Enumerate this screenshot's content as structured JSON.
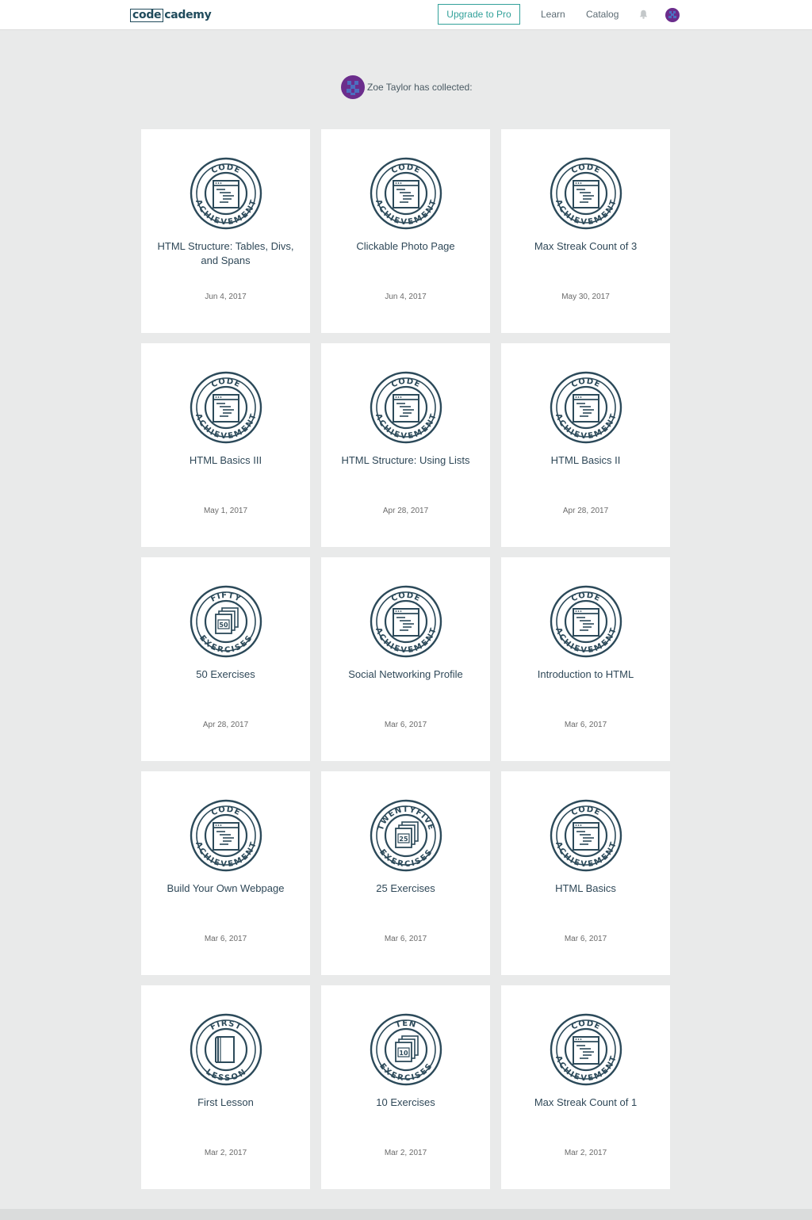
{
  "nav": {
    "logo_code": "code",
    "logo_rest": "cademy",
    "upgrade_label": "Upgrade to Pro",
    "learn_label": "Learn",
    "catalog_label": "Catalog"
  },
  "profile": {
    "name": "Zoe Taylor",
    "collected_text": "has collected:"
  },
  "colors": {
    "accent": "#32a19a",
    "badge_stroke": "#2c4a5a",
    "avatar_purple": "#6b2d8c"
  },
  "achievements": [
    {
      "title": "HTML Structure: Tables, Divs, and Spans",
      "date": "Jun 4, 2017",
      "badge": "code-achievement-icon",
      "top": "CODE",
      "bottom": "ACHIEVEMENT",
      "num": ""
    },
    {
      "title": "Clickable Photo Page",
      "date": "Jun 4, 2017",
      "badge": "code-achievement-icon",
      "top": "CODE",
      "bottom": "ACHIEVEMENT",
      "num": ""
    },
    {
      "title": "Max Streak Count of 3",
      "date": "May 30, 2017",
      "badge": "code-achievement-icon",
      "top": "CODE",
      "bottom": "ACHIEVEMENT",
      "num": ""
    },
    {
      "title": "HTML Basics III",
      "date": "May 1, 2017",
      "badge": "code-achievement-icon",
      "top": "CODE",
      "bottom": "ACHIEVEMENT",
      "num": ""
    },
    {
      "title": "HTML Structure: Using Lists",
      "date": "Apr 28, 2017",
      "badge": "code-achievement-icon",
      "top": "CODE",
      "bottom": "ACHIEVEMENT",
      "num": ""
    },
    {
      "title": "HTML Basics II",
      "date": "Apr 28, 2017",
      "badge": "code-achievement-icon",
      "top": "CODE",
      "bottom": "ACHIEVEMENT",
      "num": ""
    },
    {
      "title": "50 Exercises",
      "date": "Apr 28, 2017",
      "badge": "exercises-icon",
      "top": "FIFTY",
      "bottom": "EXERCISES",
      "num": "50"
    },
    {
      "title": "Social Networking Profile",
      "date": "Mar 6, 2017",
      "badge": "code-achievement-icon",
      "top": "CODE",
      "bottom": "ACHIEVEMENT",
      "num": ""
    },
    {
      "title": "Introduction to HTML",
      "date": "Mar 6, 2017",
      "badge": "code-achievement-icon",
      "top": "CODE",
      "bottom": "ACHIEVEMENT",
      "num": ""
    },
    {
      "title": "Build Your Own Webpage",
      "date": "Mar 6, 2017",
      "badge": "code-achievement-icon",
      "top": "CODE",
      "bottom": "ACHIEVEMENT",
      "num": ""
    },
    {
      "title": "25 Exercises",
      "date": "Mar 6, 2017",
      "badge": "exercises-icon",
      "top": "TWENTYFIVE",
      "bottom": "EXERCISES",
      "num": "25"
    },
    {
      "title": "HTML Basics",
      "date": "Mar 6, 2017",
      "badge": "code-achievement-icon",
      "top": "CODE",
      "bottom": "ACHIEVEMENT",
      "num": ""
    },
    {
      "title": "First Lesson",
      "date": "Mar 2, 2017",
      "badge": "first-lesson-icon",
      "top": "FIRST",
      "bottom": "LESSON",
      "num": ""
    },
    {
      "title": "10 Exercises",
      "date": "Mar 2, 2017",
      "badge": "exercises-icon",
      "top": "TEN",
      "bottom": "EXERCISES",
      "num": "10"
    },
    {
      "title": "Max Streak Count of 1",
      "date": "Mar 2, 2017",
      "badge": "code-achievement-icon",
      "top": "CODE",
      "bottom": "ACHIEVEMENT",
      "num": ""
    }
  ]
}
